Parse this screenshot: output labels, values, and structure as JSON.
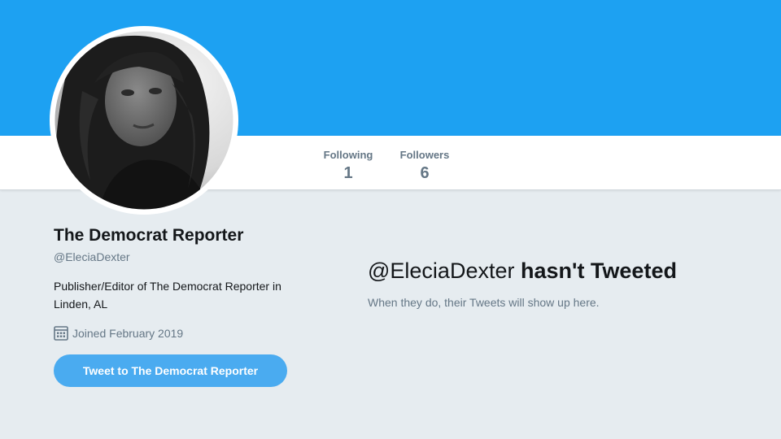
{
  "profile": {
    "name": "The Democrat Reporter",
    "handle": "@EleciaDexter",
    "bio": "Publisher/Editor of The Democrat Reporter in Linden, AL",
    "joined": "Joined February 2019",
    "joined_icon": "calendar-icon",
    "tweet_button_label": "Tweet to The Democrat Reporter"
  },
  "stats": {
    "following": {
      "label": "Following",
      "value": "1"
    },
    "followers": {
      "label": "Followers",
      "value": "6"
    }
  },
  "timeline": {
    "empty_handle": "@EleciaDexter",
    "empty_message": "hasn't Tweeted",
    "empty_sub": "When they do, their Tweets will show up here."
  },
  "colors": {
    "banner": "#1da1f2",
    "button": "#4aabf0",
    "page_bg": "#e6ecf0",
    "muted_text": "#657786"
  }
}
